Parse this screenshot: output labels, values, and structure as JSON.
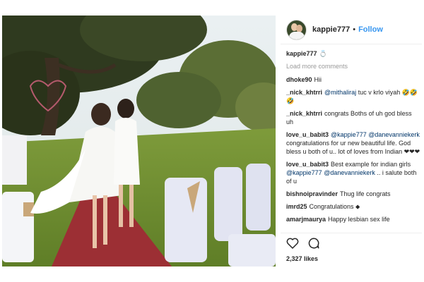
{
  "post": {
    "username": "kappie777",
    "follow_label": "Follow",
    "separator": "•",
    "caption_user": "kappie777",
    "caption_text": "💍",
    "load_more": "Load more comments",
    "comments": [
      {
        "user": "dhoke90",
        "parts": [
          {
            "t": "Hii"
          }
        ]
      },
      {
        "user": "_nick_khtrri",
        "parts": [
          {
            "t": "@mithaliraj",
            "m": true
          },
          {
            "t": " tuc v krlo viyah 🤣🤣🤣"
          }
        ]
      },
      {
        "user": "_nick_khtrri",
        "parts": [
          {
            "t": "congrats Boths of uh god bless uh"
          }
        ]
      },
      {
        "user": "love_u_babit3",
        "parts": [
          {
            "t": "@kappie777",
            "m": true
          },
          {
            "t": " "
          },
          {
            "t": "@danevanniekerk",
            "m": true
          },
          {
            "t": " congratulations for ur new beautiful life. God bless u both of u.. lot of loves from Indian ❤❤❤"
          }
        ]
      },
      {
        "user": "love_u_babit3",
        "parts": [
          {
            "t": "Best example for indian girls "
          },
          {
            "t": "@kappie777",
            "m": true
          },
          {
            "t": " "
          },
          {
            "t": "@danevanniekerk",
            "m": true
          },
          {
            "t": " .. i salute both of u"
          }
        ]
      },
      {
        "user": "bishnoipravinder",
        "parts": [
          {
            "t": "Thug life congrats"
          }
        ]
      },
      {
        "user": "imrd25",
        "parts": [
          {
            "t": "Congratulations ⬥"
          }
        ]
      },
      {
        "user": "amarjmaurya",
        "parts": [
          {
            "t": "Happy lesbian sex life"
          }
        ]
      }
    ],
    "likes": "2,327 likes",
    "icons": {
      "like": "heart-icon",
      "comment": "comment-bubble-icon"
    },
    "colors": {
      "link": "#3897f0",
      "mention": "#003569",
      "muted": "#999999"
    }
  }
}
